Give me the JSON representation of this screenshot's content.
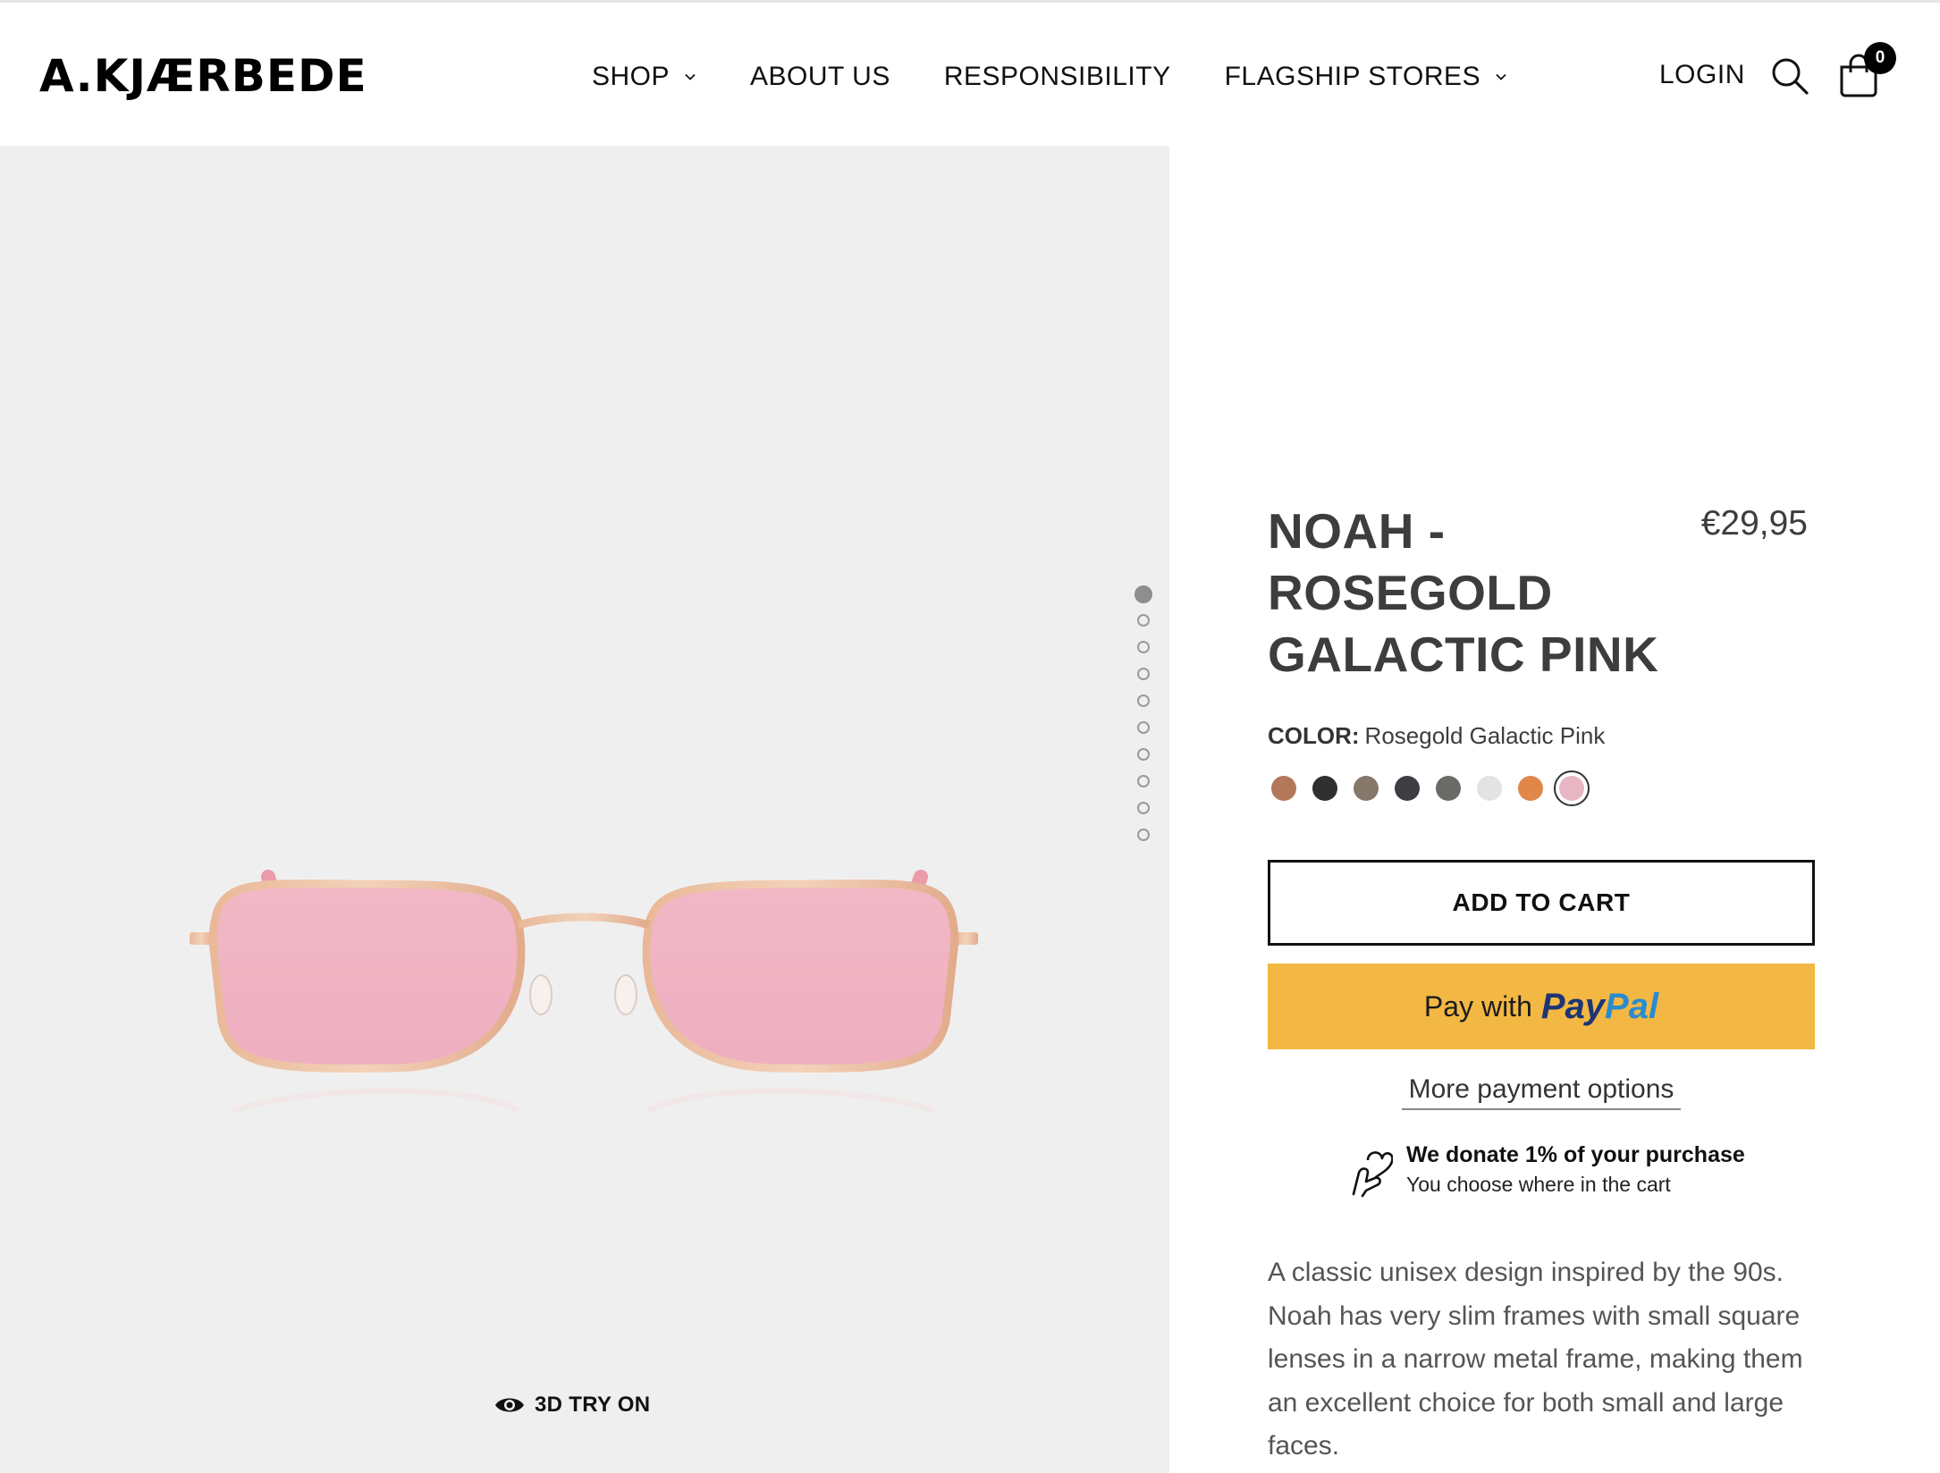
{
  "header": {
    "logo": "A.KJÆRBEDE",
    "nav": [
      {
        "label": "SHOP",
        "has_dropdown": true
      },
      {
        "label": "ABOUT US",
        "has_dropdown": false
      },
      {
        "label": "RESPONSIBILITY",
        "has_dropdown": false
      },
      {
        "label": "FLAGSHIP STORES",
        "has_dropdown": true
      }
    ],
    "login_label": "LOGIN",
    "search_icon": "search-icon",
    "cart_icon": "shopping-bag-icon",
    "cart_count": "0"
  },
  "gallery": {
    "image": "rosegold-pink-rectangular-sunglasses",
    "slide_count": 10,
    "active_slide": 1,
    "try_on_label": "3D TRY ON",
    "try_on_icon": "eye-icon"
  },
  "product": {
    "title": "NOAH - ROSEGOLD GALACTIC PINK",
    "price": "€29,95",
    "color_label": "COLOR:",
    "color_value": "Rosegold Galactic Pink",
    "swatches": [
      {
        "color": "#b3785a",
        "selected": false
      },
      {
        "color": "#2f2f2f",
        "selected": false
      },
      {
        "color": "#85786a",
        "selected": false
      },
      {
        "color": "#3c3e42",
        "selected": false
      },
      {
        "color": "#6a6a66",
        "selected": false
      },
      {
        "color": "#e3e3e3",
        "selected": false
      },
      {
        "color": "#e0874a",
        "selected": false
      },
      {
        "color": "#e9b6c4",
        "selected": true
      }
    ],
    "add_to_cart_label": "ADD TO CART",
    "paypal_prefix": "Pay with",
    "paypal_brand_1": "Pay",
    "paypal_brand_2": "Pal",
    "more_payment_label": "More payment options",
    "donate_icon": "heart-hand-icon",
    "donate_title": "We donate 1% of your purchase",
    "donate_subtitle": "You choose where in the cart",
    "description": "A classic unisex design inspired by the 90s. Noah has very slim frames with small square lenses in a narrow metal frame, making them an excellent choice for both small and large faces."
  },
  "colors": {
    "paypal_yellow": "#f3b843",
    "paypal_dark_blue": "#1d3575",
    "paypal_light_blue": "#2a8bd1",
    "gallery_bg": "#efefef"
  }
}
